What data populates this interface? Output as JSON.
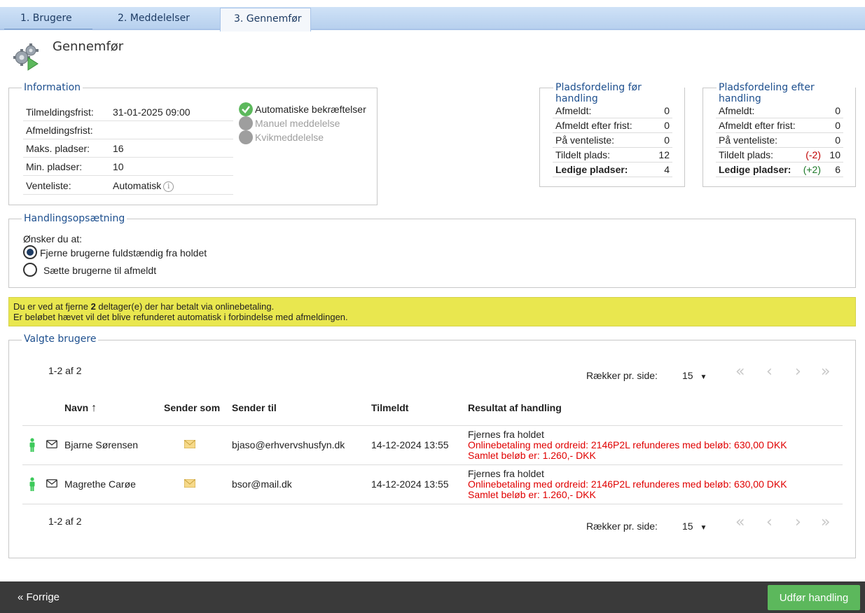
{
  "tabs": [
    {
      "label": "1. Brugere"
    },
    {
      "label": "2. Meddelelser"
    },
    {
      "label": "3. Gennemfør"
    }
  ],
  "page": {
    "title": "Gennemfør",
    "icon": "gears-play-icon"
  },
  "information": {
    "legend": "Information",
    "rows": [
      {
        "label": "Tilmeldingsfrist:",
        "value": "31-01-2025 09:00"
      },
      {
        "label": "Afmeldingsfrist:",
        "value": ""
      },
      {
        "label": "Maks. pladser:",
        "value": "16"
      },
      {
        "label": "Min. pladser:",
        "value": "10"
      },
      {
        "label": "Venteliste:",
        "value": "Automatisk"
      }
    ],
    "options": [
      {
        "label": "Automatiske bekræftelser",
        "active": true
      },
      {
        "label": "Manuel meddelelse",
        "active": false
      },
      {
        "label": "Kvikmeddelelse",
        "active": false
      }
    ],
    "colors": {
      "active": "#5cb85c",
      "inactive": "#9e9e9e"
    }
  },
  "dist_before": {
    "legend": "Pladsfordeling før handling",
    "rows": [
      {
        "label": "Afmeldt:",
        "value": "0"
      },
      {
        "label": "Afmeldt efter frist:",
        "value": "0"
      },
      {
        "label": "På venteliste:",
        "value": "0"
      },
      {
        "label": "Tildelt plads:",
        "value": "12"
      },
      {
        "label": "Ledige pladser:",
        "value": "4"
      }
    ]
  },
  "dist_after": {
    "legend": "Pladsfordeling efter handling",
    "rows": [
      {
        "label": "Afmeldt:",
        "value": "0",
        "delta": ""
      },
      {
        "label": "Afmeldt efter frist:",
        "value": "0",
        "delta": ""
      },
      {
        "label": "På venteliste:",
        "value": "0",
        "delta": ""
      },
      {
        "label": "Tildelt plads:",
        "value": "10",
        "delta": "(-2)"
      },
      {
        "label": "Ledige pladser:",
        "value": "6",
        "delta": "(+2)"
      }
    ]
  },
  "action": {
    "legend": "Handlingsopsætning",
    "question": "Ønsker du at:",
    "options": [
      {
        "label": "Fjerne brugerne fuldstændig fra holdet",
        "checked": true
      },
      {
        "label": "Sætte brugerne til afmeldt",
        "checked": false
      }
    ]
  },
  "warning": {
    "line1_pre": "Du er ved at fjerne ",
    "line1_count": "2",
    "line1_post": " deltager(e) der har betalt via onlinebetaling.",
    "line2": "Er beløbet hævet vil det blive refunderet automatisk i forbindelse med afmeldingen."
  },
  "users": {
    "legend": "Valgte brugere",
    "pager": {
      "count": "1-2 af 2",
      "rows_label": "Rækker pr. side:",
      "rows_value": "15"
    },
    "columns": {
      "name": "Navn",
      "sender_as": "Sender som",
      "sender_to": "Sender til",
      "registered": "Tilmeldt",
      "result": "Resultat af handling"
    },
    "rows": [
      {
        "name": "Bjarne Sørensen",
        "email": "bjaso@erhvervshusfyn.dk",
        "registered": "14-12-2024 13:55",
        "result1": "Fjernes fra holdet",
        "result2": "Onlinebetaling med ordreid: 2146P2L refunderes med beløb: 630,00 DKK",
        "result3": "Samlet beløb er: 1.260,- DKK"
      },
      {
        "name": "Magrethe Carøe",
        "email": "bsor@mail.dk",
        "registered": "14-12-2024 13:55",
        "result1": "Fjernes fra holdet",
        "result2": "Onlinebetaling med ordreid: 2146P2L refunderes med beløb: 630,00 DKK",
        "result3": "Samlet beløb er: 1.260,- DKK"
      }
    ]
  },
  "footer": {
    "prev_label": "« Forrige",
    "run_label": "Udfør handling"
  }
}
